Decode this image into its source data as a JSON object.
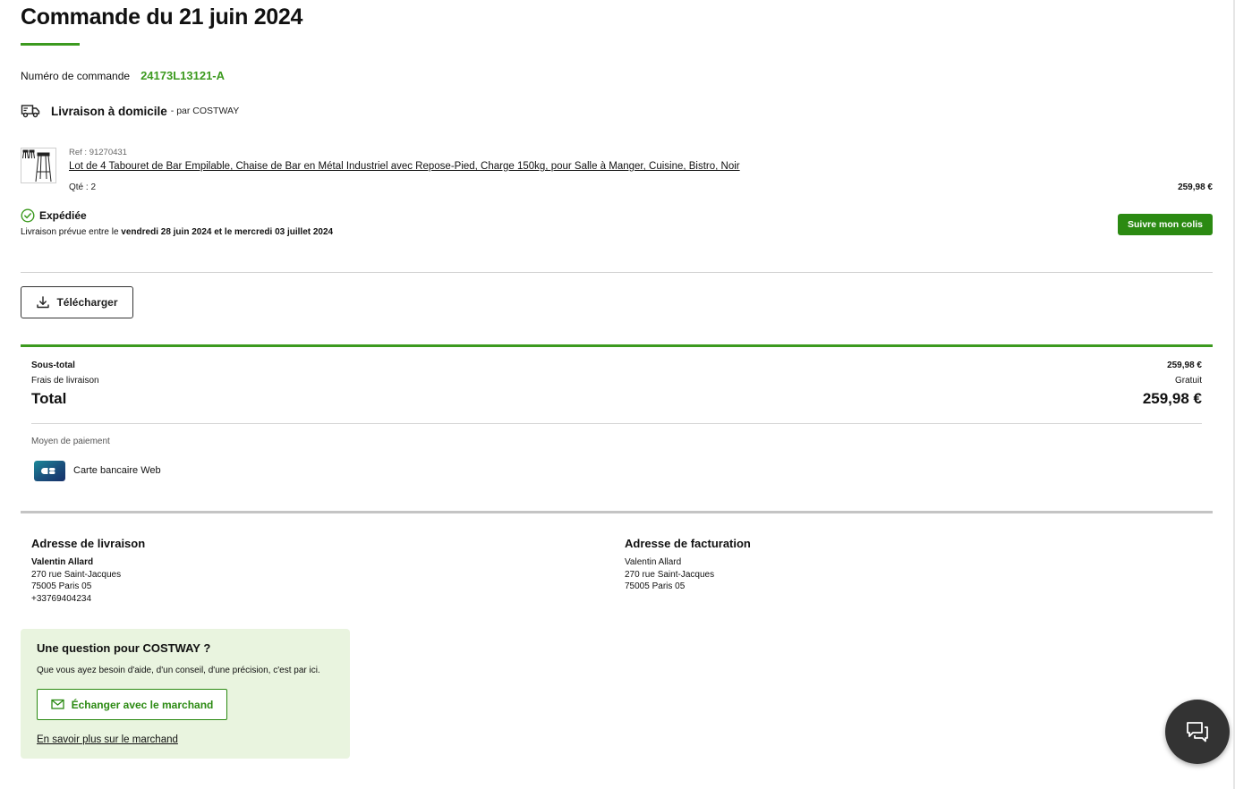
{
  "header": {
    "title": "Commande du 21 juin 2024"
  },
  "order": {
    "number_label": "Numéro de commande",
    "number": "24173L13121-A"
  },
  "delivery": {
    "mode": "Livraison à domicile",
    "by": "- par COSTWAY",
    "icon": "truck-icon"
  },
  "item": {
    "ref": "Ref : 91270431",
    "title": "Lot de 4 Tabouret de Bar Empilable, Chaise de Bar en Métal Industriel avec Repose-Pied, Charge 150kg, pour Salle à Manger, Cuisine, Bistro, Noir",
    "qty": "Qté : 2",
    "price": "259,98 €"
  },
  "status": {
    "label": "Expédiée",
    "eta_prefix": "Livraison prévue entre le",
    "eta_start": "vendredi 28 juin 2024",
    "eta_mid": "et le",
    "eta_end": "mercredi 03 juillet 2024",
    "track_button": "Suivre mon colis",
    "icon": "check-circle-icon"
  },
  "download": {
    "label": "Télécharger",
    "icon": "download-icon"
  },
  "summary": {
    "subtotal_label": "Sous-total",
    "subtotal_value": "259,98 €",
    "shipping_label": "Frais de livraison",
    "shipping_value": "Gratuit",
    "total_label": "Total",
    "total_value": "259,98 €"
  },
  "payment": {
    "label": "Moyen de paiement",
    "method": "Carte bancaire Web",
    "icon": "cb-card-icon"
  },
  "shipping_address": {
    "heading": "Adresse de livraison",
    "name": "Valentin Allard",
    "street": "270 rue Saint-Jacques",
    "city": "75005 Paris 05",
    "phone": "+33769404234"
  },
  "billing_address": {
    "heading": "Adresse de facturation",
    "name": "Valentin Allard",
    "street": "270 rue Saint-Jacques",
    "city": "75005 Paris 05"
  },
  "question": {
    "title": "Une question pour COSTWAY ?",
    "text": "Que vous ayez besoin d'aide, d'un conseil, d'une précision, c'est par ici.",
    "button": "Échanger avec le marchand",
    "link": "En savoir plus sur le marchand"
  },
  "chat": {
    "icon": "chat-icon"
  },
  "colors": {
    "accent_green": "#3c9a1f",
    "button_green": "#2b8a12",
    "question_bg": "#e9f4df",
    "chat_fab": "#333333"
  }
}
